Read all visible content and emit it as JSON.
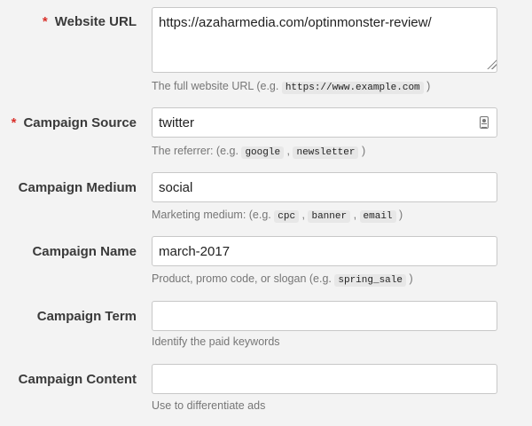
{
  "form": {
    "website_url": {
      "label": "Website URL",
      "required_mark": "*",
      "value": "https://azaharmedia.com/optinmonster-review/",
      "hint_before": "The full website URL (e.g. ",
      "hint_code": "https://www.example.com",
      "hint_after": " )"
    },
    "campaign_source": {
      "label": "Campaign Source",
      "required_mark": "*",
      "value": "twitter",
      "icon": "contact-card-icon",
      "hint_before": "The referrer: (e.g. ",
      "hint_code_1": "google",
      "hint_sep": " , ",
      "hint_code_2": "newsletter",
      "hint_after": " )"
    },
    "campaign_medium": {
      "label": "Campaign Medium",
      "value": "social",
      "hint_before": "Marketing medium: (e.g. ",
      "hint_code_1": "cpc",
      "hint_sep_1": " , ",
      "hint_code_2": "banner",
      "hint_sep_2": " , ",
      "hint_code_3": "email",
      "hint_after": " )"
    },
    "campaign_name": {
      "label": "Campaign Name",
      "value": "march-2017",
      "hint_before": "Product, promo code, or slogan (e.g. ",
      "hint_code": "spring_sale",
      "hint_after": " )"
    },
    "campaign_term": {
      "label": "Campaign Term",
      "value": "",
      "hint": "Identify the paid keywords"
    },
    "campaign_content": {
      "label": "Campaign Content",
      "value": "",
      "hint": "Use to differentiate ads"
    }
  },
  "colors": {
    "background": "#f3f3f3",
    "required": "#d9302a",
    "hint_text": "#767676",
    "code_background": "#e7e7e7"
  }
}
